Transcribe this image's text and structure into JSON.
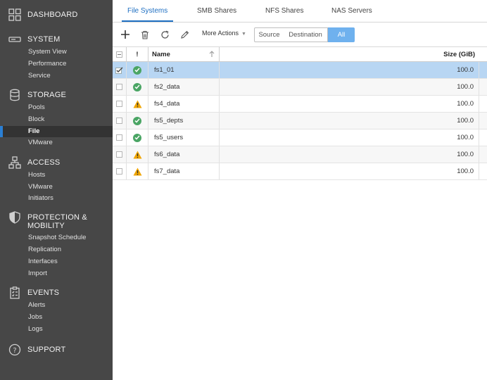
{
  "sidebar": {
    "dashboard": "DASHBOARD",
    "system": {
      "label": "SYSTEM",
      "items": [
        "System View",
        "Performance",
        "Service"
      ]
    },
    "storage": {
      "label": "STORAGE",
      "items": [
        "Pools",
        "Block",
        "File",
        "VMware"
      ],
      "active": "File"
    },
    "access": {
      "label": "ACCESS",
      "items": [
        "Hosts",
        "VMware",
        "Initiators"
      ]
    },
    "protection": {
      "label_line1": "PROTECTION &",
      "label_line2": "MOBILITY",
      "items": [
        "Snapshot Schedule",
        "Replication",
        "Interfaces",
        "Import"
      ]
    },
    "events": {
      "label": "EVENTS",
      "items": [
        "Alerts",
        "Jobs",
        "Logs"
      ]
    },
    "support": "SUPPORT"
  },
  "tabs": [
    "File Systems",
    "SMB Shares",
    "NFS Shares",
    "NAS Servers"
  ],
  "active_tab": "File Systems",
  "toolbar": {
    "add_icon": "plus-icon",
    "delete_icon": "trash-icon",
    "refresh_icon": "refresh-icon",
    "edit_icon": "pencil-icon",
    "more_actions": "More Actions",
    "filters": [
      "Source",
      "Destination",
      "All"
    ],
    "active_filter": "All"
  },
  "table": {
    "headers": {
      "status": "!",
      "name": "Name",
      "size": "Size (GiB)"
    },
    "sort_icon": "sort-up-arrow-icon",
    "rows": [
      {
        "name": "fs1_01",
        "status": "ok",
        "size": "100.0",
        "selected": true
      },
      {
        "name": "fs2_data",
        "status": "ok",
        "size": "100.0"
      },
      {
        "name": "fs4_data",
        "status": "warning",
        "size": "100.0"
      },
      {
        "name": "fs5_depts",
        "status": "ok",
        "size": "100.0"
      },
      {
        "name": "fs5_users",
        "status": "ok",
        "size": "100.0"
      },
      {
        "name": "fs6_data",
        "status": "warning",
        "size": "100.0"
      },
      {
        "name": "fs7_data",
        "status": "warning",
        "size": "100.0"
      }
    ]
  },
  "colors": {
    "accent": "#1e6fc2",
    "ok": "#4aa564",
    "warning": "#f0a500",
    "sidebar": "#474747",
    "selected_row": "#b8d6f3"
  }
}
